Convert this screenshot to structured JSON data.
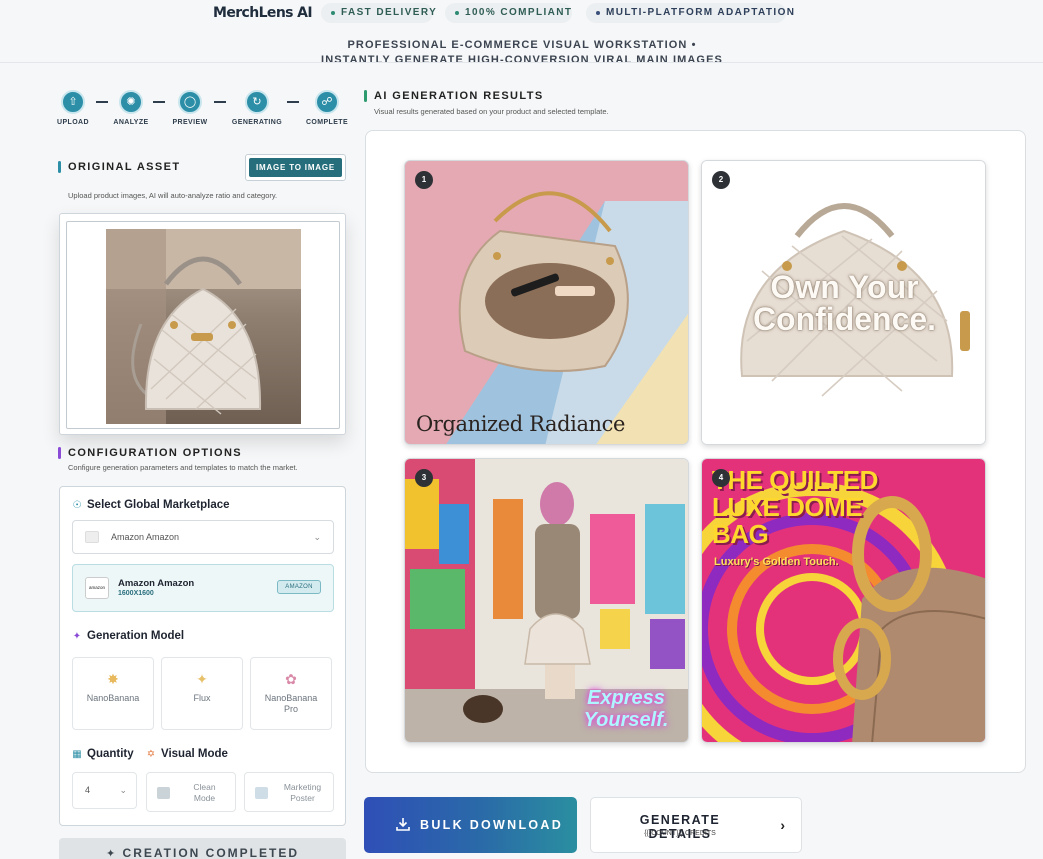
{
  "header": {
    "logo": "MerchLens AI",
    "badges": [
      "FAST DELIVERY",
      "100% COMPLIANT",
      "MULTI-PLATFORM ADAPTATION"
    ],
    "headline_line1": "PROFESSIONAL E-COMMERCE VISUAL WORKSTATION •",
    "headline_line2": "INSTANTLY GENERATE HIGH-CONVERSION VIRAL MAIN IMAGES"
  },
  "stepper": {
    "steps": [
      {
        "label": "UPLOAD",
        "icon": "upload-icon"
      },
      {
        "label": "ANALYZE",
        "icon": "analyze-icon"
      },
      {
        "label": "PREVIEW",
        "icon": "bulb-icon"
      },
      {
        "label": "GENERATING",
        "icon": "refresh-icon"
      },
      {
        "label": "COMPLETE",
        "icon": "shield-icon"
      }
    ]
  },
  "original_asset": {
    "title": "ORIGINAL ASSET",
    "subtitle": "Upload product images, AI will auto-analyze ratio and category.",
    "mode_button": "IMAGE TO IMAGE"
  },
  "configuration": {
    "title": "CONFIGURATION OPTIONS",
    "subtitle": "Configure generation parameters and templates to match the market.",
    "marketplace_heading": "Select Global Marketplace",
    "marketplace_select": "Amazon Amazon",
    "selected_market": {
      "name": "Amazon Amazon",
      "size": "1600X1600",
      "badge": "AMAZON",
      "logo_text": "amazon"
    },
    "model_heading": "Generation Model",
    "models": [
      {
        "line1": "NanoBanana",
        "line2": "",
        "icon": "banana-icon"
      },
      {
        "line1": "Flux",
        "line2": "",
        "icon": "sparkle-icon"
      },
      {
        "line1": "NanoBanana",
        "line2": "Pro",
        "icon": "palette-icon"
      }
    ],
    "quantity_heading": "Quantity",
    "quantity_value": "4",
    "visual_mode_heading": "Visual Mode",
    "visual_modes": [
      {
        "line1": "Clean",
        "line2": "Mode"
      },
      {
        "line1": "Marketing",
        "line2": "Poster"
      }
    ],
    "status_button": "CREATION COMPLETED"
  },
  "results": {
    "title": "AI GENERATION RESULTS",
    "subtitle": "Visual results generated based on your product and selected template.",
    "tiles": [
      {
        "number": "1",
        "caption": "Organized Radiance"
      },
      {
        "number": "2",
        "caption_line1": "Own Your",
        "caption_line2": "Confidence."
      },
      {
        "number": "3",
        "caption_line1": "Express",
        "caption_line2": "Yourself."
      },
      {
        "number": "4",
        "caption_line1": "THE QUILTED",
        "caption_line2": "LUXE DOME",
        "caption_line3": "BAG",
        "caption_sub": "Luxury's Golden Touch."
      }
    ]
  },
  "actions": {
    "bulk_download": "BULK DOWNLOAD",
    "generate_details": "GENERATE DETAILS",
    "credits": "{{{COUNT}}} CREDITS"
  },
  "colors": {
    "accent_teal": "#266e7c",
    "step_circle": "#2c8fa7",
    "bulk_gradient_start": "#2f4fb7",
    "bulk_gradient_end": "#2a8fa0"
  }
}
